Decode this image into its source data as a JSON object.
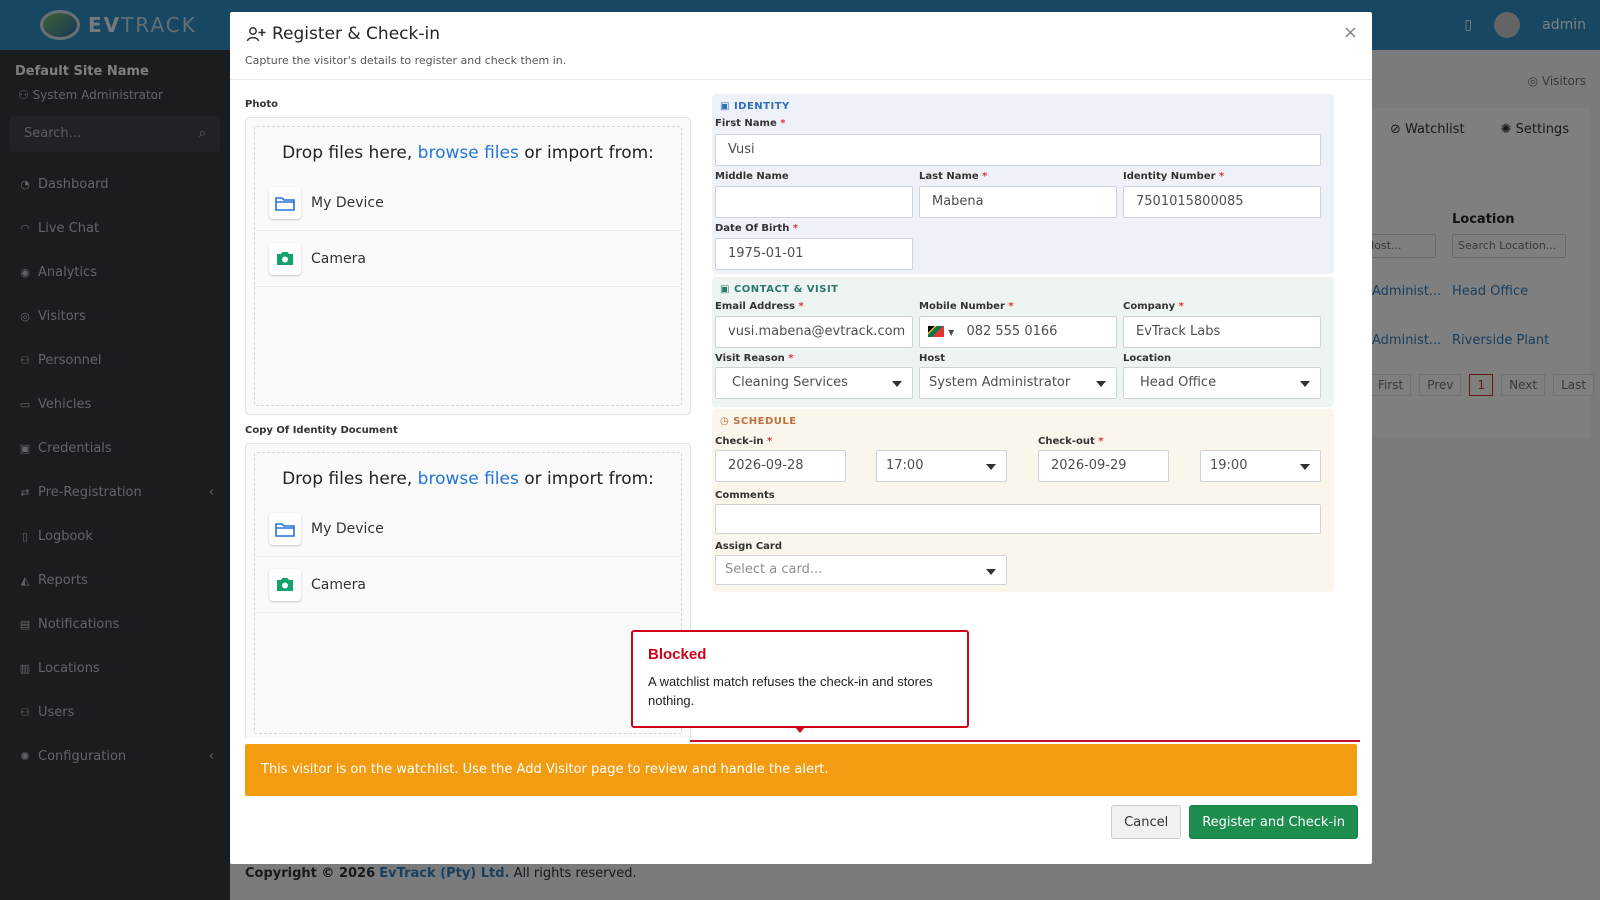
{
  "app": {
    "brand_a": "EV",
    "brand_b": "TRACK",
    "user": "admin"
  },
  "sidebar": {
    "site_name": "Default Site Name",
    "role": "System Administrator",
    "search_placeholder": "Search...",
    "items": [
      {
        "label": "Dashboard",
        "icon": "dashboard-icon"
      },
      {
        "label": "Live Chat",
        "icon": "headset-icon"
      },
      {
        "label": "Analytics",
        "icon": "analytics-icon"
      },
      {
        "label": "Visitors",
        "icon": "eye-icon"
      },
      {
        "label": "Personnel",
        "icon": "personnel-icon"
      },
      {
        "label": "Vehicles",
        "icon": "car-icon"
      },
      {
        "label": "Credentials",
        "icon": "id-card-icon"
      },
      {
        "label": "Pre-Registration",
        "icon": "exchange-icon"
      },
      {
        "label": "Logbook",
        "icon": "book-icon"
      },
      {
        "label": "Reports",
        "icon": "chart-icon"
      },
      {
        "label": "Notifications",
        "icon": "bell-icon"
      },
      {
        "label": "Locations",
        "icon": "building-icon"
      },
      {
        "label": "Users",
        "icon": "users-icon"
      },
      {
        "label": "Configuration",
        "icon": "gear-icon"
      }
    ]
  },
  "background": {
    "breadcrumb": "Visitors",
    "tab_watchlist": "Watchlist",
    "tab_settings": "Settings",
    "col_location": "Location",
    "host_filter": "Host...",
    "location_filter": "Search Location...",
    "rows": [
      {
        "host": "Administ...",
        "location": "Head Office"
      },
      {
        "host": "Administ...",
        "location": "Riverside Plant"
      }
    ],
    "pager": {
      "first": "First",
      "prev": "Prev",
      "page": "1",
      "next": "Next",
      "last": "Last"
    },
    "footer": {
      "copy": "Copyright © 2026",
      "company": "EvTrack (Pty) Ltd.",
      "rights": "All rights reserved."
    }
  },
  "modal": {
    "title": "Register & Check-in",
    "subtitle": "Capture the visitor's details to register and check them in.",
    "photo_label": "Photo",
    "id_doc_label": "Copy Of Identity Document",
    "dropzone": {
      "prefix": "Drop files here, ",
      "browse": "browse files",
      "suffix": " or import from:",
      "device": "My Device",
      "camera": "Camera"
    },
    "identity": {
      "heading": "IDENTITY",
      "first_name_label": "First Name",
      "first_name": "Vusi",
      "middle_name_label": "Middle Name",
      "middle_name": "",
      "last_name_label": "Last Name",
      "last_name": "Mabena",
      "id_number_label": "Identity Number",
      "id_number": "7501015800085",
      "dob_label": "Date Of Birth",
      "dob": "1975-01-01"
    },
    "contact": {
      "heading": "CONTACT & VISIT",
      "email_label": "Email Address",
      "email": "vusi.mabena@evtrack.com",
      "mobile_label": "Mobile Number",
      "mobile": "082 555 0166",
      "company_label": "Company",
      "company": "EvTrack Labs",
      "reason_label": "Visit Reason",
      "reason": "Cleaning Services",
      "host_label": "Host",
      "host": "System Administrator",
      "location_label": "Location",
      "location": "Head Office"
    },
    "schedule": {
      "heading": "SCHEDULE",
      "checkin_label": "Check-in",
      "checkin_date": "2026-09-28",
      "checkin_time": "17:00",
      "checkout_label": "Check-out",
      "checkout_date": "2026-09-29",
      "checkout_time": "19:00",
      "comments_label": "Comments",
      "card_label": "Assign Card",
      "card_placeholder": "Select a card..."
    },
    "cancel_label": "Cancel",
    "register_label": "Register and Check-in"
  },
  "alert": {
    "text": "This visitor is on the watchlist. Use the Add Visitor page to review and handle the alert."
  },
  "tooltip": {
    "title": "Blocked",
    "body": "A watchlist match refuses the check-in and stores nothing."
  },
  "colors": {
    "topbar": "#2f8ec5",
    "sidebar": "#343a40",
    "warning": "#f39c12",
    "danger": "#d0021b",
    "success": "#1e8e4e"
  }
}
